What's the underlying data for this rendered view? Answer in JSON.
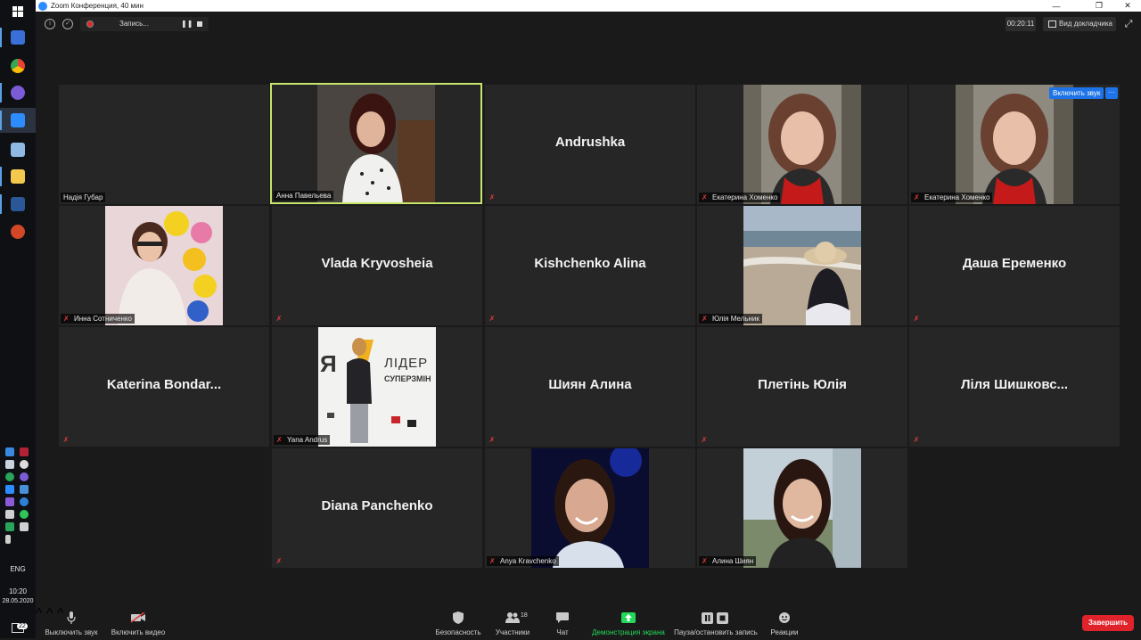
{
  "window": {
    "title": "Zoom Конференция, 40 мин"
  },
  "taskbar": {
    "language": "ENG",
    "time": "10:20",
    "date": "28.05.2020",
    "notifications": "22"
  },
  "topbar": {
    "recording_label": "Запись...",
    "timer": "00:20:11",
    "speaker_view_label": "Вид докладчика"
  },
  "tile_actions": {
    "unmute_label": "Включить звук",
    "more_label": "···"
  },
  "participants": [
    {
      "name": "Надія Губар",
      "display": "",
      "video": false,
      "muted": false
    },
    {
      "name": "Анна Павельева",
      "display": "",
      "video": true,
      "muted": false,
      "speaking": true
    },
    {
      "name": "",
      "display": "Andrushka",
      "video": false,
      "muted": true
    },
    {
      "name": "Екатерина Хоменко",
      "display": "",
      "video": true,
      "muted": true
    },
    {
      "name": "Екатерина Хоменко",
      "display": "",
      "video": true,
      "muted": true
    },
    {
      "name": "Инна Сотниченко",
      "display": "",
      "video": true,
      "muted": true
    },
    {
      "name": "",
      "display": "Vlada Kryvosheia",
      "video": false,
      "muted": true
    },
    {
      "name": "",
      "display": "Kishchenko Alina",
      "video": false,
      "muted": true
    },
    {
      "name": "Юлія Мельник",
      "display": "",
      "video": true,
      "muted": true
    },
    {
      "name": "",
      "display": "Даша Еременко",
      "video": false,
      "muted": true
    },
    {
      "name": "",
      "display": "Katerina  Bondar...",
      "video": false,
      "muted": true
    },
    {
      "name": "Yana Andrus",
      "display": "",
      "video": true,
      "muted": true
    },
    {
      "name": "",
      "display": "Шиян Алина",
      "video": false,
      "muted": true
    },
    {
      "name": "",
      "display": "Плетінь Юлія",
      "video": false,
      "muted": true
    },
    {
      "name": "",
      "display": "Ліля  Шишковс...",
      "video": false,
      "muted": true
    },
    {
      "name": "",
      "display": "Diana Panchenko",
      "video": false,
      "muted": true
    },
    {
      "name": "Anya Kravchenko",
      "display": "",
      "video": true,
      "muted": true
    },
    {
      "name": "Алина Шиян",
      "display": "",
      "video": true,
      "muted": true
    }
  ],
  "poster_text": {
    "line1": "Я",
    "line2": "ЛІДЕР",
    "line3": "СУПЕРЗМІН"
  },
  "controls": {
    "mute_label": "Выключить звук",
    "video_label": "Включить видео",
    "security_label": "Безопасность",
    "participants_label": "Участники",
    "participants_count": "18",
    "chat_label": "Чат",
    "share_label": "Демонстрация экрана",
    "record_label": "Пауза/остановить запись",
    "reactions_label": "Реакции",
    "end_label": "Завершить"
  },
  "colors": {
    "accent_blue": "#1e73e8",
    "speaking_border": "#c6e56b",
    "end_red": "#e0222b",
    "share_green": "#23d959",
    "muted_red": "#e23b3b"
  }
}
